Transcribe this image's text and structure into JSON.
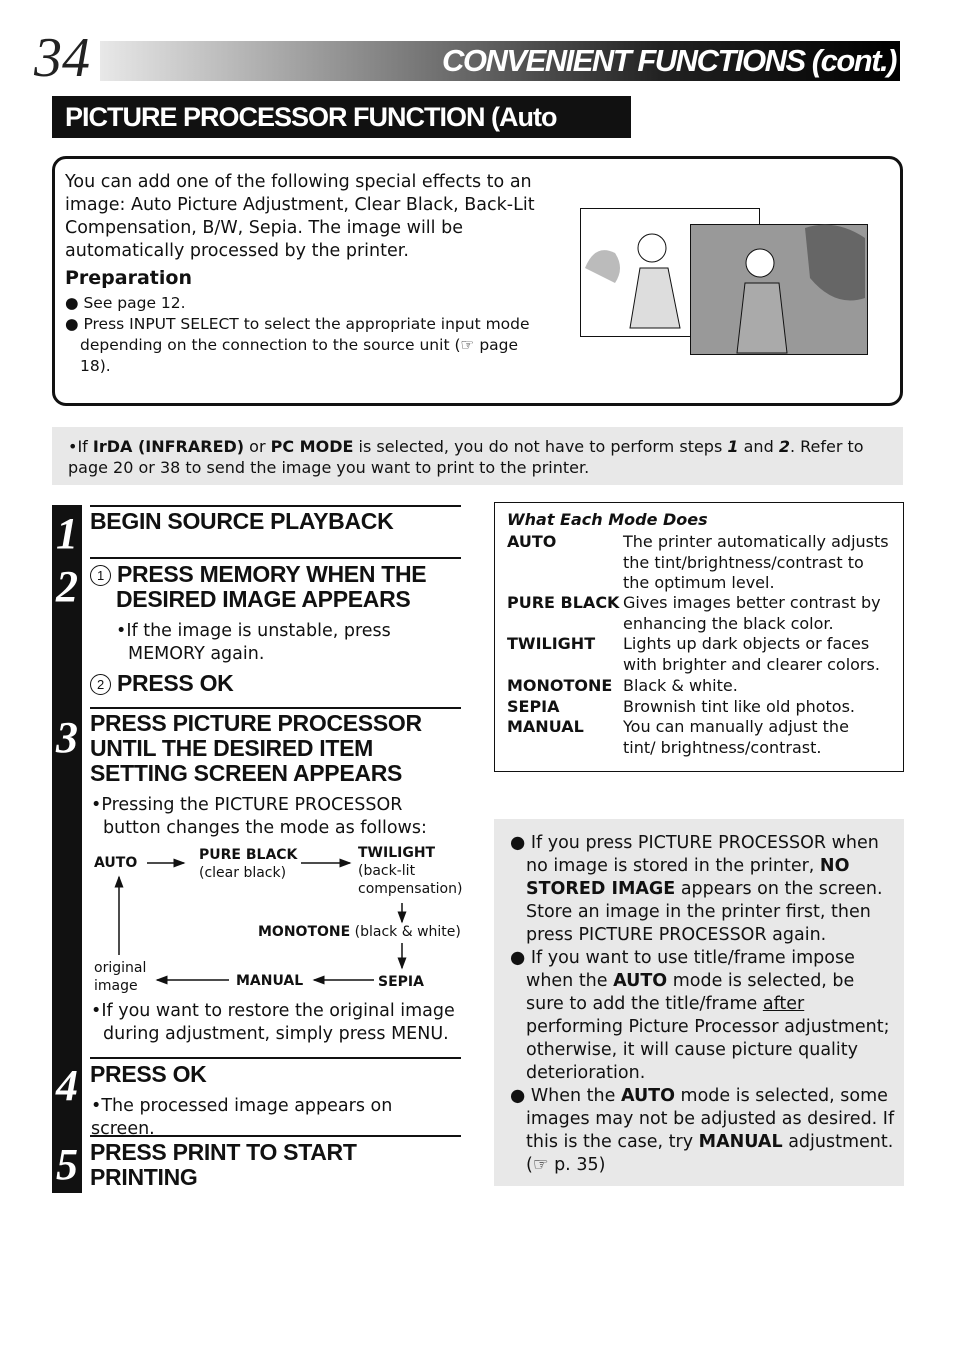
{
  "header": {
    "page_number": "34",
    "title": "CONVENIENT FUNCTIONS (cont.)"
  },
  "section_title": "PICTURE PROCESSOR FUNCTION (Auto Adjustment)",
  "intro": {
    "text": "You can add one of the following special effects to an image: Auto Picture Adjustment, Clear Black, Back-Lit Compensation, B/W, Sepia. The image will be automatically processed by the printer.",
    "preparation_title": "Preparation",
    "bullets": [
      "See page 12.",
      "Press INPUT SELECT to select the appropriate input mode depending on the connection to the source unit (☞ page 18)."
    ]
  },
  "note": {
    "pre": "If ",
    "irda": "IrDA (INFRARED)",
    "or": " or ",
    "pc": "PC MODE",
    "mid": " is selected, you do not have to perform steps ",
    "s1": "1",
    "and": " and ",
    "s2": "2",
    "post": ". Refer to page 20 or 38 to send the image you want to print to the printer."
  },
  "steps": [
    {
      "num": "1",
      "title": "BEGIN SOURCE PLAYBACK"
    },
    {
      "num": "2",
      "sub1_num": "1",
      "sub1": "PRESS MEMORY WHEN THE DESIRED IMAGE APPEARS",
      "bullet": "If the image is unstable, press MEMORY again.",
      "sub2_num": "2",
      "sub2": "PRESS OK"
    },
    {
      "num": "3",
      "title": "PRESS PICTURE PROCESSOR UNTIL THE DESIRED ITEM SETTING SCREEN APPEARS",
      "bullet1": "Pressing the PICTURE PROCESSOR button changes the mode as follows:",
      "bullet2": "If you want to restore the original image during adjustment, simply press MENU."
    },
    {
      "num": "4",
      "title": "PRESS OK",
      "bullet": "The processed image appears on screen."
    },
    {
      "num": "5",
      "title": "PRESS PRINT TO START PRINTING"
    }
  ],
  "flow": {
    "auto": "AUTO",
    "pure_black": "PURE BLACK",
    "pure_black_sub": "(clear black)",
    "twilight": "TWILIGHT",
    "twilight_sub": "(back-lit compensation)",
    "monotone": "MONOTONE",
    "monotone_sub": "(black & white)",
    "sepia": "SEPIA",
    "manual": "MANUAL",
    "original": "original image"
  },
  "modes": {
    "title": "What Each Mode Does",
    "items": [
      {
        "name": "AUTO",
        "desc": "The printer automatically adjusts the tint/brightness/contrast to the optimum level."
      },
      {
        "name": "PURE BLACK",
        "desc": "Gives images better contrast by enhancing the black color."
      },
      {
        "name": "TWILIGHT",
        "desc": "Lights up dark objects or faces with brighter and clearer colors."
      },
      {
        "name": "MONOTONE",
        "desc": "Black & white."
      },
      {
        "name": "SEPIA",
        "desc": "Brownish tint like old photos."
      },
      {
        "name": "MANUAL",
        "desc": "You can manually adjust the tint/ brightness/contrast."
      }
    ]
  },
  "tips": [
    {
      "a": "If you press PICTURE PROCESSOR when no image is stored in the printer, ",
      "b": "NO STORED IMAGE",
      "c": " appears on the screen. Store an image in the printer first, then press PICTURE PROCESSOR again."
    },
    {
      "a": "If you want to use title/frame impose when the ",
      "b": "AUTO",
      "c": " mode is selected, be sure to add the title/frame ",
      "u": "after",
      "d": " performing Picture Processor adjustment; otherwise, it will cause picture quality deterioration."
    },
    {
      "a": "When the ",
      "b": "AUTO",
      "c": " mode is selected, some images may not be adjusted as desired. If this is the case, try ",
      "e": "MANUAL",
      "f": " adjustment. (☞ p. 35)"
    }
  ]
}
